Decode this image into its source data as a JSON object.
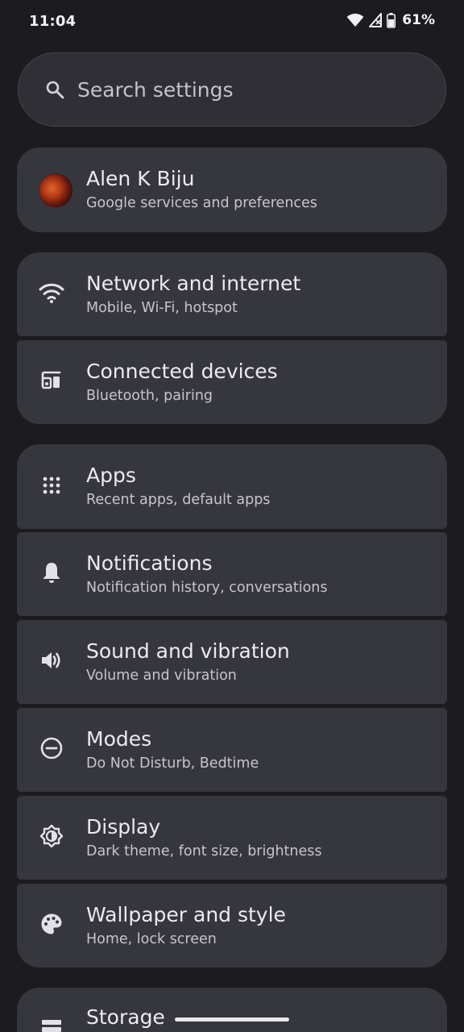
{
  "status_bar": {
    "time": "11:04",
    "battery_percent": "61%",
    "icons": [
      "wifi-icon",
      "cell-signal-icon",
      "battery-icon"
    ]
  },
  "search": {
    "placeholder": "Search settings"
  },
  "account": {
    "name": "Alen K Biju",
    "subtitle": "Google services and preferences"
  },
  "settings": [
    {
      "title": "Network and internet",
      "subtitle": "Mobile, Wi-Fi, hotspot",
      "icon": "wifi-icon"
    },
    {
      "title": "Connected devices",
      "subtitle": "Bluetooth, pairing",
      "icon": "connected-devices-icon"
    },
    {
      "title": "Apps",
      "subtitle": "Recent apps, default apps",
      "icon": "apps-grid-icon"
    },
    {
      "title": "Notifications",
      "subtitle": "Notification history, conversations",
      "icon": "bell-icon"
    },
    {
      "title": "Sound and vibration",
      "subtitle": "Volume and vibration",
      "icon": "speaker-icon"
    },
    {
      "title": "Modes",
      "subtitle": "Do Not Disturb, Bedtime",
      "icon": "do-not-disturb-icon"
    },
    {
      "title": "Display",
      "subtitle": "Dark theme, font size, brightness",
      "icon": "brightness-icon"
    },
    {
      "title": "Wallpaper and style",
      "subtitle": "Home, lock screen",
      "icon": "palette-icon"
    },
    {
      "title": "Storage",
      "subtitle": "",
      "icon": "storage-icon"
    }
  ],
  "colors": {
    "background": "#1c1c20",
    "card": "#36363d",
    "search": "#2f2f35",
    "text_primary": "#ebeaf0",
    "text_secondary": "#c6c5cd"
  }
}
